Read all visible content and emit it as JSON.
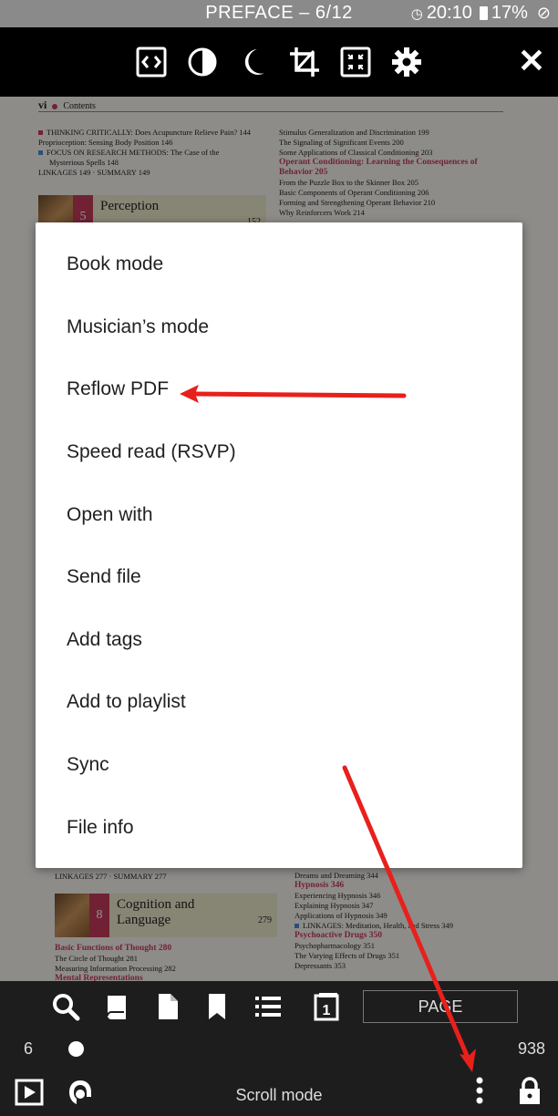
{
  "status_bar": {
    "title": "PREFACE – 6/12",
    "time": "20:10",
    "battery": "17%"
  },
  "toolbar": {
    "icons": [
      "fit-width-icon",
      "contrast-icon",
      "night-mode-icon",
      "crop-icon",
      "fullscreen-icon",
      "settings-icon",
      "close-icon"
    ],
    "close_label": "✕"
  },
  "page": {
    "header_num": "vi",
    "header_text": "Contents",
    "left_col": [
      {
        "t": "THINKING CRITICALLY: Does Acupuncture Relieve Pain?  144",
        "b": "pink"
      },
      {
        "t": "Proprioception: Sensing Body Position  146"
      },
      {
        "t": "FOCUS ON RESEARCH METHODS: The Case of the",
        "b": "blue"
      },
      {
        "t": "Mysterious Spells  148"
      },
      {
        "t": "LINKAGES  149  ·  SUMMARY  149"
      }
    ],
    "right_col": [
      {
        "t": "Stimulus Generalization and Discrimination  199"
      },
      {
        "t": "The Signaling of Significant Events  200"
      },
      {
        "t": "Some Applications of Classical Conditioning  203"
      },
      {
        "t": "Operant Conditioning: Learning the Consequences of",
        "pink": true
      },
      {
        "t": "Behavior  205",
        "pink": true
      },
      {
        "t": "From the Puzzle Box to the Skinner Box  205"
      },
      {
        "t": "Basic Components of Operant Conditioning  206"
      },
      {
        "t": "Forming and Strengthening Operant Behavior  210"
      },
      {
        "t": "Why Reinforcers Work  214"
      }
    ],
    "chapter5": {
      "num": "5",
      "name": "Perception",
      "page": "152"
    },
    "left_col2": [
      {
        "t": "LINKAGES  277  ·  SUMMARY  277"
      }
    ],
    "chapter8": {
      "num": "8",
      "name": "Cognition and\nLanguage",
      "page": "279"
    },
    "left_col3": [
      {
        "t": "Basic Functions of Thought  280",
        "pink": true
      },
      {
        "t": "The Circle of Thought  281"
      },
      {
        "t": "Measuring Information Processing  282"
      },
      {
        "t": "Mental Representations",
        "pink": true
      }
    ],
    "right_col2": [
      {
        "t": "Dreams and Dreaming  344"
      },
      {
        "t": "Hypnosis  346",
        "pink": true
      },
      {
        "t": "Experiencing Hypnosis  346"
      },
      {
        "t": "Explaining Hypnosis  347"
      },
      {
        "t": "Applications of Hypnosis  349"
      },
      {
        "t": "LINKAGES: Meditation, Health, and Stress  349",
        "b": "blue"
      },
      {
        "t": "Psychoactive Drugs  350",
        "pink": true
      },
      {
        "t": "Psychopharmacology  351"
      },
      {
        "t": "The Varying Effects of Drugs  351"
      },
      {
        "t": "Depressants  353"
      }
    ]
  },
  "menu": {
    "items": [
      "Book mode",
      "Musician’s mode",
      "Reflow PDF",
      "Speed read (RSVP)",
      "Open with",
      "Send file",
      "Add tags",
      "Add to playlist",
      "Sync",
      "File info"
    ]
  },
  "bottom_bar": {
    "icons": [
      "search-icon",
      "book-icon",
      "document-icon",
      "bookmark-icon",
      "list-icon",
      "page-number-icon"
    ],
    "page_button": "PAGE",
    "current_page": "6",
    "total_pages": "938",
    "progress": 0.006,
    "scroll_mode": "Scroll mode",
    "bottom_icons": [
      "play-icon",
      "tts-icon",
      "more-vert-icon",
      "lock-icon"
    ]
  },
  "colors": {
    "accent_pink": "#c23b5a",
    "annotation_red": "#e8201c",
    "toolbar_bg": "#000000",
    "status_bg": "#8a8a8a"
  }
}
